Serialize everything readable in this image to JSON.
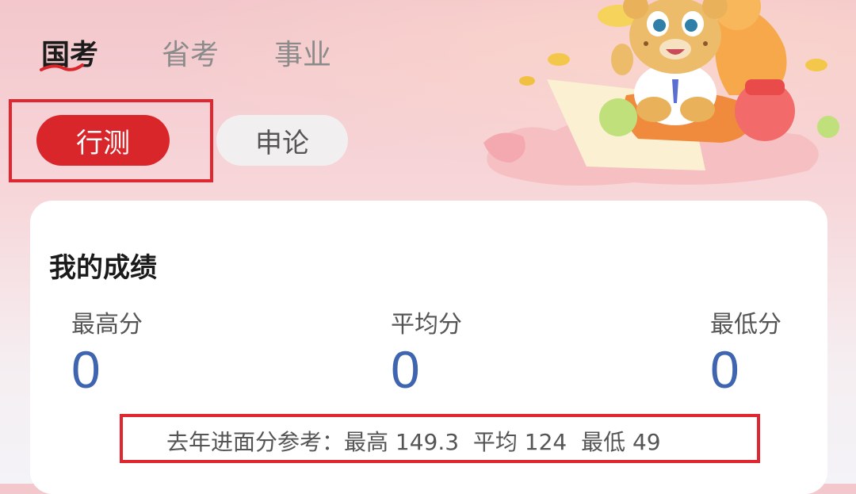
{
  "tabs": {
    "guokao": "国考",
    "shengkao": "省考",
    "shiye": "事业"
  },
  "subjects": {
    "xingce": "行测",
    "shenlun": "申论"
  },
  "scores": {
    "title": "我的成绩",
    "max_label": "最高分",
    "max_value": "0",
    "avg_label": "平均分",
    "avg_value": "0",
    "min_label": "最低分",
    "min_value": "0"
  },
  "reference": {
    "prefix": "去年进面分参考：",
    "max_text": "最高 149.3",
    "avg_text": "平均 124",
    "min_text": "最低 49"
  },
  "colors": {
    "accent_red": "#d8262b",
    "score_blue": "#3f64b0"
  }
}
